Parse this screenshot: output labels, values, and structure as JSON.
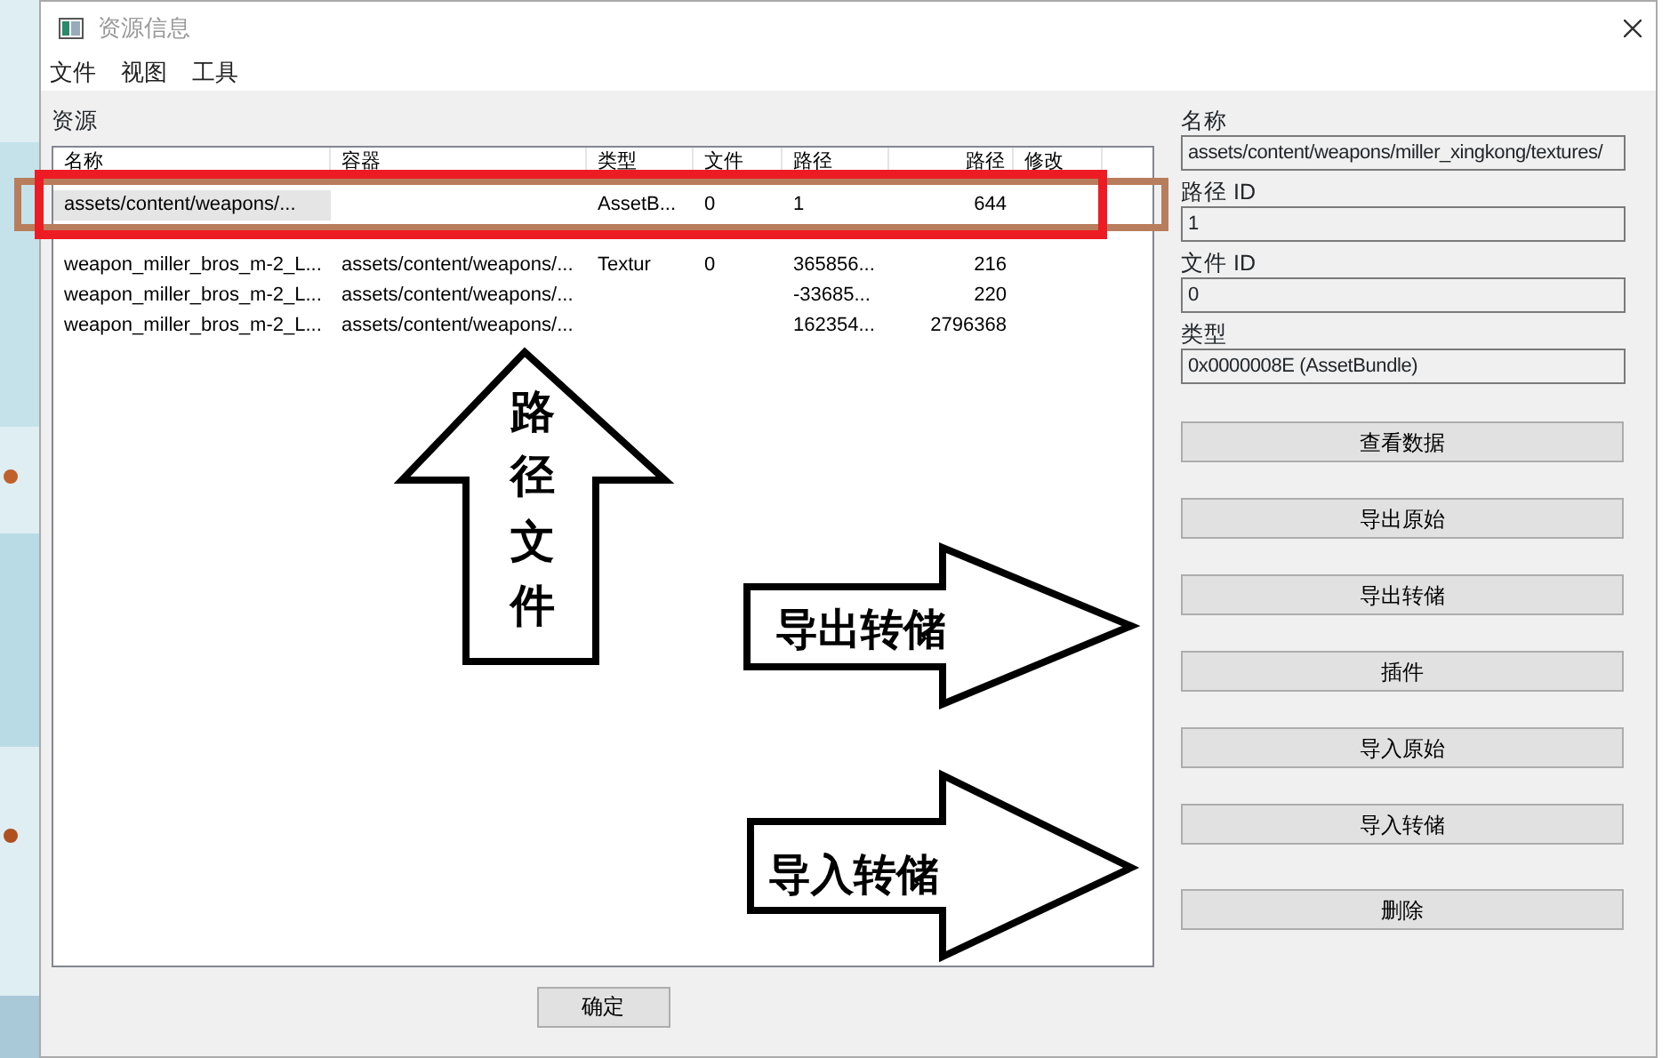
{
  "window": {
    "title": "资源信息"
  },
  "menu": [
    "文件",
    "视图",
    "工具"
  ],
  "assets": {
    "label": "资源",
    "columns": [
      "名称",
      "容器",
      "类型",
      "文件",
      "路径",
      "路径",
      "修改"
    ],
    "rows": [
      {
        "selected": true,
        "cells": [
          "assets/content/weapons/...",
          "",
          "AssetB...",
          "0",
          "1",
          "644",
          ""
        ]
      },
      {
        "selected": false,
        "cells": [
          "weapon_miller_bros_m-2_L...",
          "assets/content/weapons/...",
          "Textur",
          "0",
          "365856...",
          "216",
          ""
        ]
      },
      {
        "selected": false,
        "cells": [
          "weapon_miller_bros_m-2_L...",
          "assets/content/weapons/...",
          "",
          "",
          "-33685...",
          "220",
          ""
        ]
      },
      {
        "selected": false,
        "cells": [
          "weapon_miller_bros_m-2_L...",
          "assets/content/weapons/...",
          "",
          "",
          "162354...",
          "2796368",
          ""
        ]
      }
    ]
  },
  "details": [
    {
      "label": "名称",
      "value": "assets/content/weapons/miller_xingkong/textures/"
    },
    {
      "label": "路径 ID",
      "value": "1"
    },
    {
      "label": "文件 ID",
      "value": "0"
    },
    {
      "label": "类型",
      "value": "0x0000008E (AssetBundle)"
    }
  ],
  "actions": [
    "查看数据",
    "导出原始",
    "导出转储",
    "插件",
    "导入原始",
    "导入转储",
    "删除"
  ],
  "ok_button": "确定",
  "annotations": [
    {
      "kind": "box",
      "color": "#b87d5c"
    },
    {
      "kind": "box",
      "color": "#ed1c24"
    },
    {
      "kind": "up-arrow",
      "label": "路径文件"
    },
    {
      "kind": "right-arrow",
      "label": "导出转储"
    },
    {
      "kind": "right-arrow",
      "label": "导入转储"
    }
  ]
}
